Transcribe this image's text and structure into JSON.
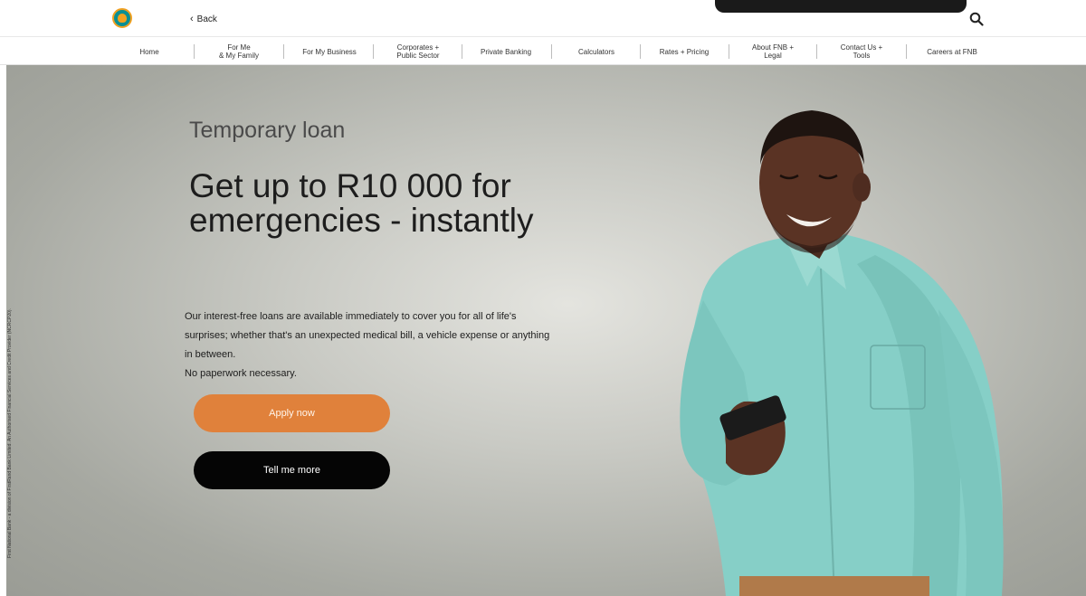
{
  "header": {
    "back_label": "Back"
  },
  "nav": {
    "items": [
      {
        "label": "Home"
      },
      {
        "label": "For Me\n& My Family"
      },
      {
        "label": "For My Business"
      },
      {
        "label": "Corporates +\nPublic Sector"
      },
      {
        "label": "Private Banking"
      },
      {
        "label": "Calculators"
      },
      {
        "label": "Rates + Pricing"
      },
      {
        "label": "About FNB +\nLegal"
      },
      {
        "label": "Contact Us +\nTools"
      },
      {
        "label": "Careers at FNB"
      }
    ]
  },
  "hero": {
    "eyebrow": "Temporary loan",
    "headline": "Get up to R10 000 for emergencies - instantly",
    "body_line1": "Our interest-free loans are available immediately to cover you for all of life's surprises; whether that's an unexpected medical bill, a vehicle expense or anything in between.",
    "body_line2": "No paperwork necessary.",
    "apply_label": "Apply now",
    "more_label": "Tell me more",
    "legal_text": "First National Bank - a division of FirstRand Bank Limited. An Authorised Financial Services and Credit Provider (NCRCP20)."
  },
  "colors": {
    "accent": "#e0813b",
    "brand_teal": "#0a8f93"
  }
}
